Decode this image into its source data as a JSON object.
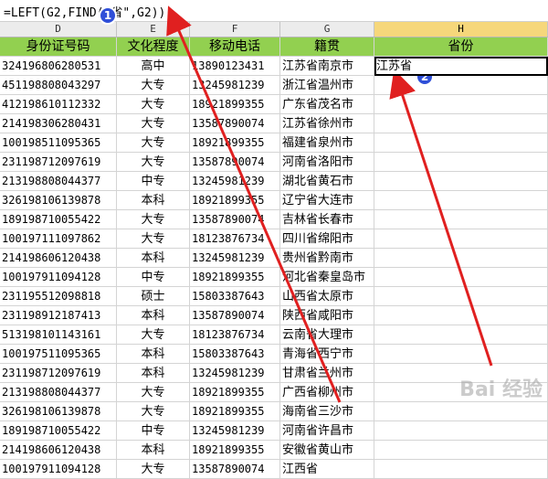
{
  "formula_bar": {
    "formula": "=LEFT(G2,FIND(\"省\",G2))"
  },
  "columns": [
    {
      "letter": "D",
      "active": false
    },
    {
      "letter": "E",
      "active": false
    },
    {
      "letter": "F",
      "active": false
    },
    {
      "letter": "G",
      "active": false
    },
    {
      "letter": "H",
      "active": true
    }
  ],
  "headers": [
    "身份证号码",
    "文化程度",
    "移动电话",
    "籍贯",
    "省份"
  ],
  "rows": [
    {
      "id": "324196806280531",
      "edu": "高中",
      "phone": "13890123431",
      "place": "江苏省南京市",
      "province": "江苏省"
    },
    {
      "id": "451198808043297",
      "edu": "大专",
      "phone": "13245981239",
      "place": "浙江省温州市",
      "province": ""
    },
    {
      "id": "412198610112332",
      "edu": "大专",
      "phone": "18921899355",
      "place": "广东省茂名市",
      "province": ""
    },
    {
      "id": "214198306280431",
      "edu": "大专",
      "phone": "13587890074",
      "place": "江苏省徐州市",
      "province": ""
    },
    {
      "id": "100198511095365",
      "edu": "大专",
      "phone": "18921899355",
      "place": "福建省泉州市",
      "province": ""
    },
    {
      "id": "231198712097619",
      "edu": "大专",
      "phone": "13587890074",
      "place": "河南省洛阳市",
      "province": ""
    },
    {
      "id": "213198808044377",
      "edu": "中专",
      "phone": "13245981239",
      "place": "湖北省黄石市",
      "province": ""
    },
    {
      "id": "326198106139878",
      "edu": "本科",
      "phone": "18921899355",
      "place": "辽宁省大连市",
      "province": ""
    },
    {
      "id": "189198710055422",
      "edu": "大专",
      "phone": "13587890074",
      "place": "吉林省长春市",
      "province": ""
    },
    {
      "id": "100197111097862",
      "edu": "大专",
      "phone": "18123876734",
      "place": "四川省绵阳市",
      "province": ""
    },
    {
      "id": "214198606120438",
      "edu": "本科",
      "phone": "13245981239",
      "place": "贵州省黔南市",
      "province": ""
    },
    {
      "id": "100197911094128",
      "edu": "中专",
      "phone": "18921899355",
      "place": "河北省秦皇岛市",
      "province": ""
    },
    {
      "id": "231195512098818",
      "edu": "硕士",
      "phone": "15803387643",
      "place": "山西省太原市",
      "province": ""
    },
    {
      "id": "231198912187413",
      "edu": "本科",
      "phone": "13587890074",
      "place": "陕西省咸阳市",
      "province": ""
    },
    {
      "id": "513198101143161",
      "edu": "大专",
      "phone": "18123876734",
      "place": "云南省大理市",
      "province": ""
    },
    {
      "id": "100197511095365",
      "edu": "本科",
      "phone": "15803387643",
      "place": "青海省西宁市",
      "province": ""
    },
    {
      "id": "231198712097619",
      "edu": "本科",
      "phone": "13245981239",
      "place": "甘肃省兰州市",
      "province": ""
    },
    {
      "id": "213198808044377",
      "edu": "大专",
      "phone": "18921899355",
      "place": "广西省柳州市",
      "province": ""
    },
    {
      "id": "326198106139878",
      "edu": "大专",
      "phone": "18921899355",
      "place": "海南省三沙市",
      "province": ""
    },
    {
      "id": "189198710055422",
      "edu": "中专",
      "phone": "13245981239",
      "place": "河南省许昌市",
      "province": ""
    },
    {
      "id": "214198606120438",
      "edu": "本科",
      "phone": "18921899355",
      "place": "安徽省黄山市",
      "province": ""
    },
    {
      "id": "100197911094128",
      "edu": "大专",
      "phone": "13587890074",
      "place": "江西省",
      "province": ""
    }
  ],
  "markers": [
    "1",
    "2"
  ],
  "watermark": "Bai 经验",
  "colors": {
    "header_fill": "#92d050",
    "active_col": "#f6d77b",
    "marker_blue": "#2f4fd8",
    "arrow_red": "#e02020"
  }
}
